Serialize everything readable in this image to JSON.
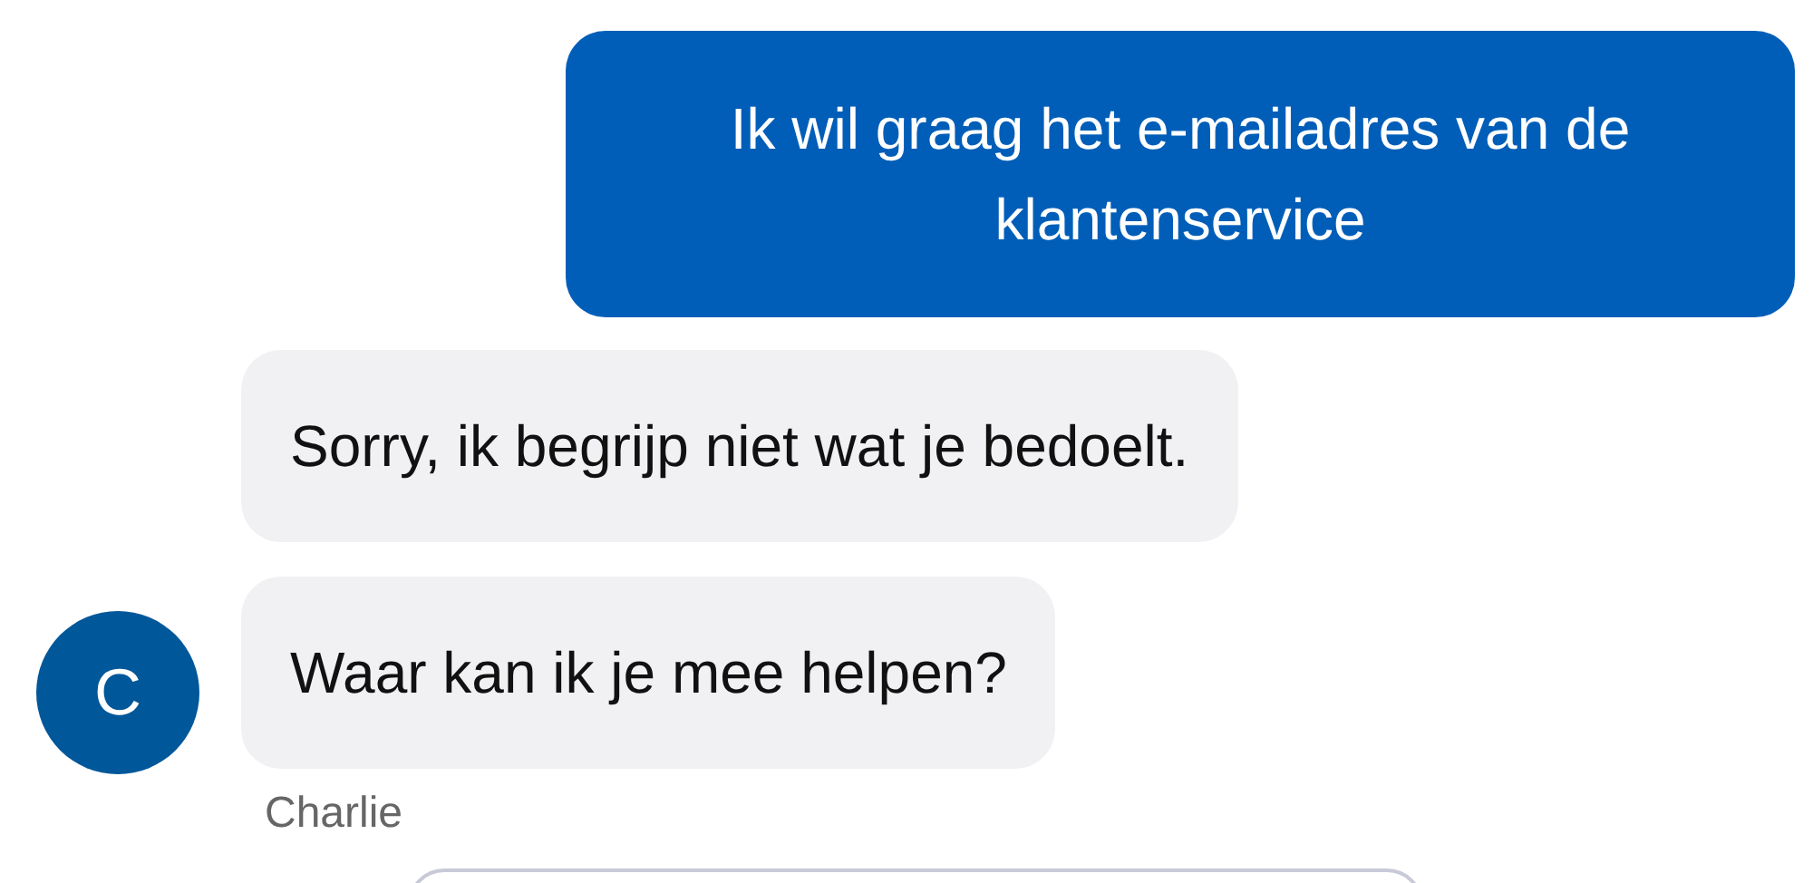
{
  "messages": [
    {
      "kind": "outgoing",
      "text": "Ik wil graag het e-mailadres van de klantenservice"
    },
    {
      "kind": "incoming",
      "text": "Sorry, ik begrijp niet wat je bedoelt.",
      "avatar": false
    },
    {
      "kind": "incoming",
      "text": "Waar kan ik je mee helpen?",
      "avatar": true
    }
  ],
  "avatar_letter": "C",
  "sender_name": "Charlie",
  "quick_replies": [
    {
      "kind": "option"
    }
  ]
}
